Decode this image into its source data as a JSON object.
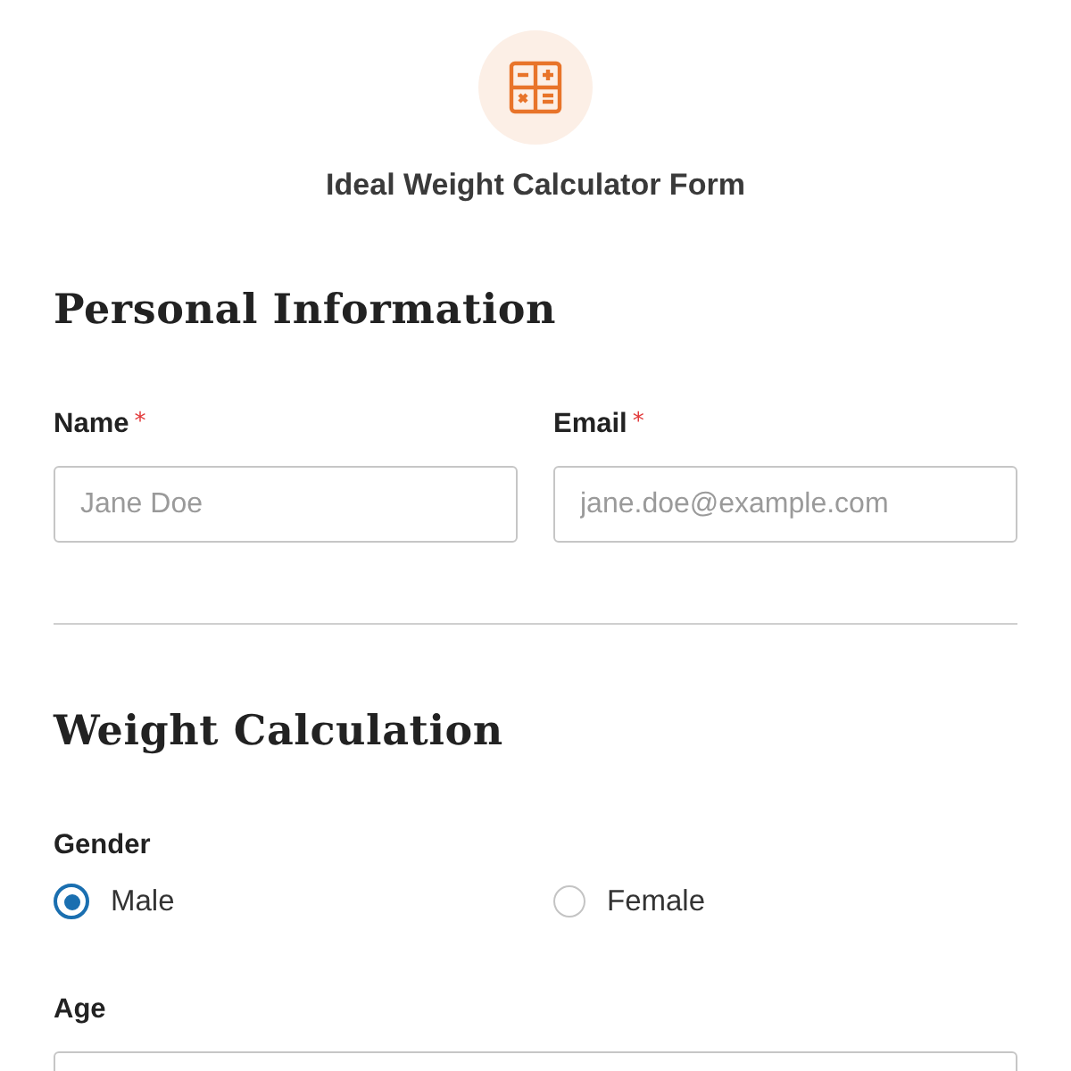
{
  "header": {
    "title": "Ideal Weight Calculator Form"
  },
  "sections": [
    {
      "heading": "Personal Information",
      "rows": [
        [
          {
            "kind": "text",
            "label": "Name",
            "required_mark": "*",
            "placeholder": "Jane Doe"
          },
          {
            "kind": "text",
            "label": "Email",
            "required_mark": "*",
            "placeholder": "jane.doe@example.com"
          }
        ]
      ]
    },
    {
      "heading": "Weight Calculation",
      "rows": [
        [
          {
            "kind": "radio",
            "label": "Gender",
            "options": [
              {
                "label": "Male",
                "selected": true
              },
              {
                "label": "Female",
                "selected": false
              }
            ]
          }
        ],
        [
          {
            "kind": "text",
            "label": "Age"
          }
        ]
      ]
    }
  ]
}
